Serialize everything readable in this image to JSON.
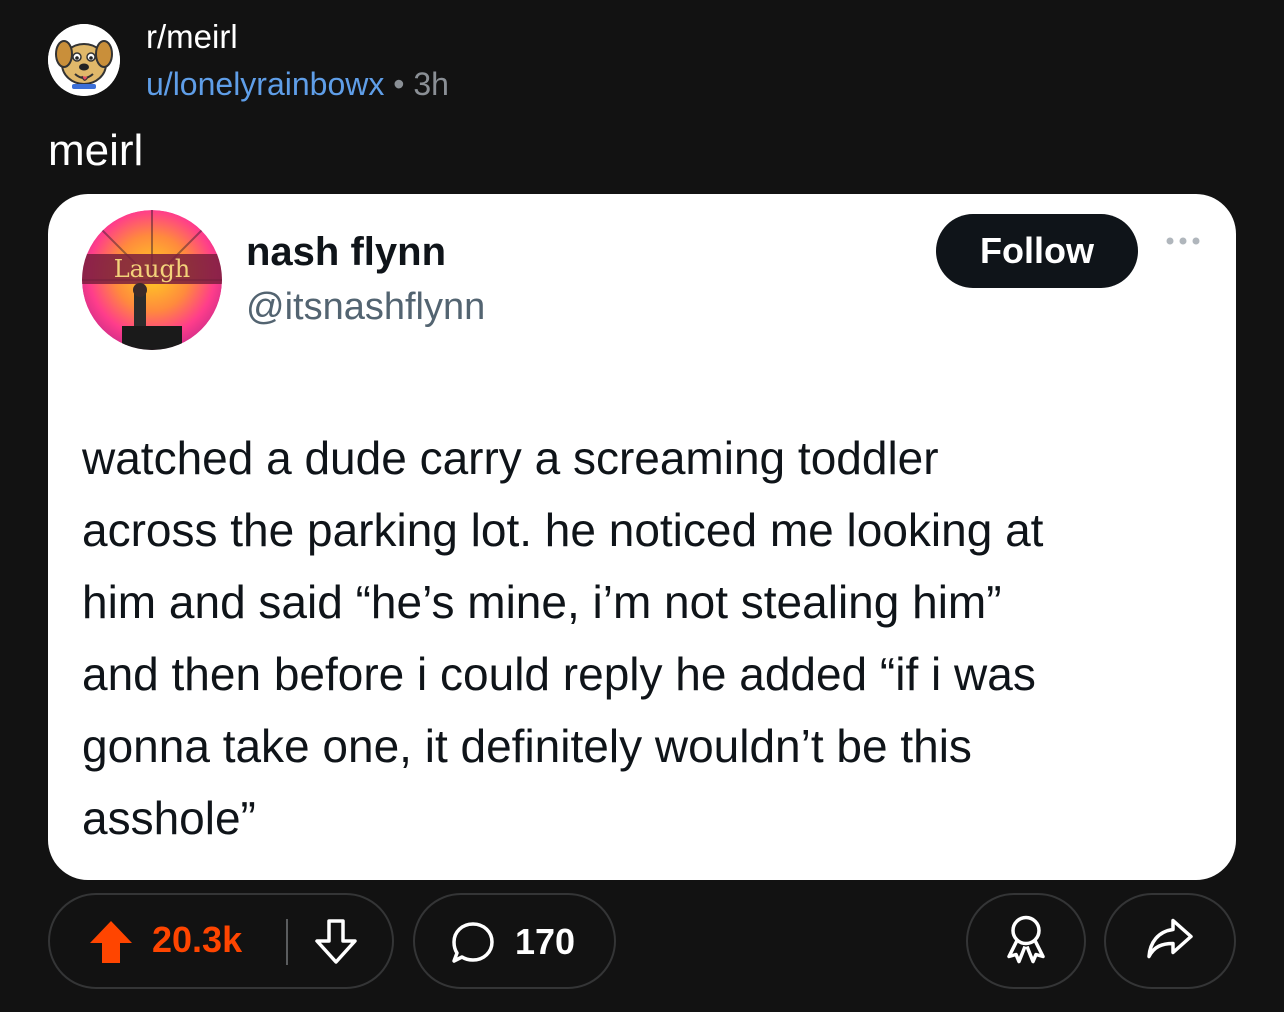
{
  "post": {
    "subreddit": "r/meirl",
    "author": "u/lonelyrainbowx",
    "separator": "•",
    "age": "3h",
    "title": "meirl",
    "subreddit_icon": "cartoon-dog-avatar"
  },
  "tweet": {
    "name": "nash flynn",
    "handle": "@itsnashflynn",
    "follow_label": "Follow",
    "avatar_icon": "laugh-factory-avatar",
    "avatar_text": "Laugh",
    "text": "watched a dude carry a screaming toddler\nacross the parking lot. he noticed me looking at\nhim and said “he’s mine, i’m not stealing him”\nand then before i could reply he added “if i was\ngonna take one, it definitely wouldn’t be this\nasshole”"
  },
  "actions": {
    "score": "20.3k",
    "comments": "170",
    "upvote_icon": "upvote-arrow-icon",
    "downvote_icon": "downvote-arrow-icon",
    "comment_icon": "speech-bubble-icon",
    "award_icon": "award-ribbon-icon",
    "share_icon": "share-arrow-icon"
  },
  "colors": {
    "background": "#121212",
    "upvote_orange": "#ff4500",
    "username_blue": "#5f9ee8",
    "meta_gray": "#8a8f95",
    "card_bg": "#ffffff",
    "follow_bg": "#0f1419"
  }
}
